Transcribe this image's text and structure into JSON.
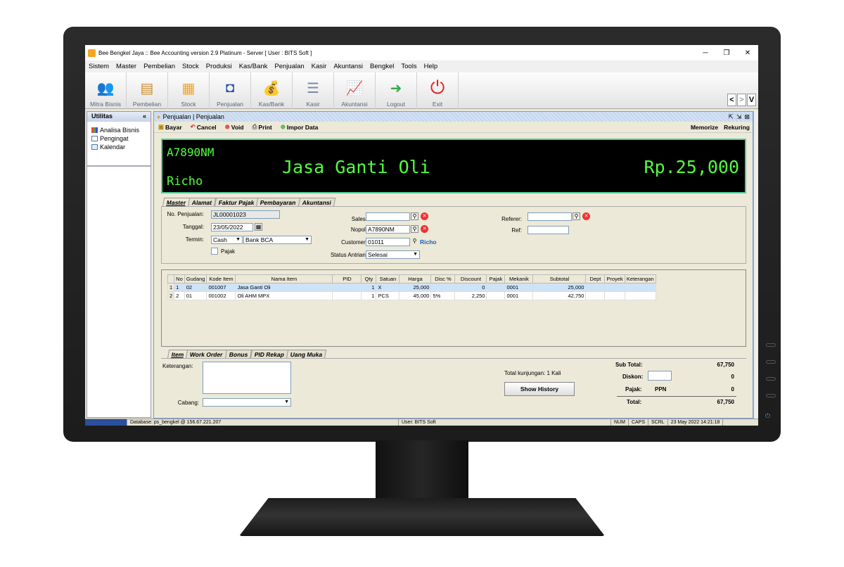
{
  "window": {
    "title": "Bee Bengkel Jaya :: Bee Accounting version 2.9 Platinum - Server  [ User : BITS Soft ]"
  },
  "menu": [
    "Sistem",
    "Master",
    "Pembelian",
    "Stock",
    "Produksi",
    "Kas/Bank",
    "Penjualan",
    "Kasir",
    "Akuntansi",
    "Bengkel",
    "Tools",
    "Help"
  ],
  "toolbar": [
    {
      "label": "Mitra Bisnis",
      "icon": "people-icon"
    },
    {
      "label": "Pembelian",
      "icon": "purchase-icon"
    },
    {
      "label": "Stock",
      "icon": "boxes-icon"
    },
    {
      "label": "Penjualan",
      "icon": "shopping-bag-icon"
    },
    {
      "label": "Kas/Bank",
      "icon": "money-bag-icon"
    },
    {
      "label": "Kasir",
      "icon": "cash-register-icon"
    },
    {
      "label": "Akuntansi",
      "icon": "growth-chart-icon"
    },
    {
      "label": "Logout",
      "icon": "logout-arrow-icon"
    },
    {
      "label": "Exit",
      "icon": "power-icon"
    }
  ],
  "nav": {
    "prev": "<",
    "next": ">",
    "v": "V"
  },
  "sidebar": {
    "header": "Utilitas",
    "items": [
      "Analisa Bisnis",
      "Pengingat",
      "Kalendar"
    ]
  },
  "child": {
    "title": "Penjualan | Penjualan",
    "actions": [
      "Bayar",
      "Cancel",
      "Void",
      "Print",
      "Impor Data"
    ],
    "actions_right": [
      "Memorize",
      "Rekuring"
    ]
  },
  "display": {
    "plate": "A7890NM",
    "customer": "Richo",
    "item": "Jasa Ganti Oli",
    "amount": "Rp.25,000"
  },
  "master_tabs": [
    "Master",
    "Alamat",
    "Faktur Pajak",
    "Pembayaran",
    "Akuntansi"
  ],
  "form": {
    "no_label": "No. Penjualan:",
    "no_value": "JL00001023",
    "tanggal_label": "Tanggal:",
    "tanggal_value": "23/05/2022",
    "termin_label": "Termin:",
    "termin_value": "Cash",
    "bank_value": "Bank BCA",
    "pajak_label": "Pajak",
    "sales_label": "Sales:",
    "sales_value": "",
    "nopol_label": "Nopol:",
    "nopol_value": "A7890NM",
    "customer_label": "Customer:",
    "customer_value": "01011",
    "customer_name": "Richo",
    "status_label": "Status Antrian:",
    "status_value": "Selesai",
    "referer_label": "Referer:",
    "referer_value": "",
    "ref_label": "Ref:",
    "ref_value": ""
  },
  "grid": {
    "headers": [
      "No",
      "Gudang",
      "Kode Item",
      "Nama Item",
      "PID",
      "Qty",
      "Satuan",
      "Harga",
      "Disc %",
      "Discount",
      "Pajak",
      "Mekanik",
      "Subtotal",
      "Dept",
      "Proyek",
      "Keterangan"
    ],
    "rows": [
      {
        "row": "1",
        "no": "1",
        "gudang": "02",
        "kode": "001007",
        "nama": "Jasa Ganti Oli",
        "pid": "",
        "qty": "1",
        "satuan": "X",
        "harga": "25,000",
        "disc": "",
        "discount": "0",
        "pajak": "",
        "mekanik": "0001",
        "subtotal": "25,000",
        "dept": "",
        "proyek": "",
        "ket": ""
      },
      {
        "row": "2",
        "no": "2",
        "gudang": "01",
        "kode": "001002",
        "nama": "Oli AHM MPX",
        "pid": "",
        "qty": "1",
        "satuan": "PCS",
        "harga": "45,000",
        "disc": "5%",
        "discount": "2,250",
        "pajak": "",
        "mekanik": "0001",
        "subtotal": "42,750",
        "dept": "",
        "proyek": "",
        "ket": ""
      }
    ]
  },
  "bottom_tabs": [
    "Item",
    "Work Order",
    "Bonus",
    "PID Rekap",
    "Uang Muka"
  ],
  "bottom": {
    "keterangan_label": "Keterangan:",
    "cabang_label": "Cabang:",
    "kunjungan": "Total kunjungan:  1 Kali",
    "history_button": "Show History",
    "subtotal_label": "Sub Total:",
    "subtotal_value": "67,750",
    "diskon_label": "Diskon:",
    "diskon_value": "0",
    "pajak_label": "Pajak:",
    "pajak_type": "PPN",
    "pajak_value": "0",
    "total_label": "Total:",
    "total_value": "67,750"
  },
  "status": {
    "database": "Database: ps_bengkel @ 156.67.221.207",
    "user": "User: BITS Soft",
    "num": "NUM",
    "caps": "CAPS",
    "scrl": "SCRL",
    "datetime": "23 May 2022   14:21:18"
  }
}
